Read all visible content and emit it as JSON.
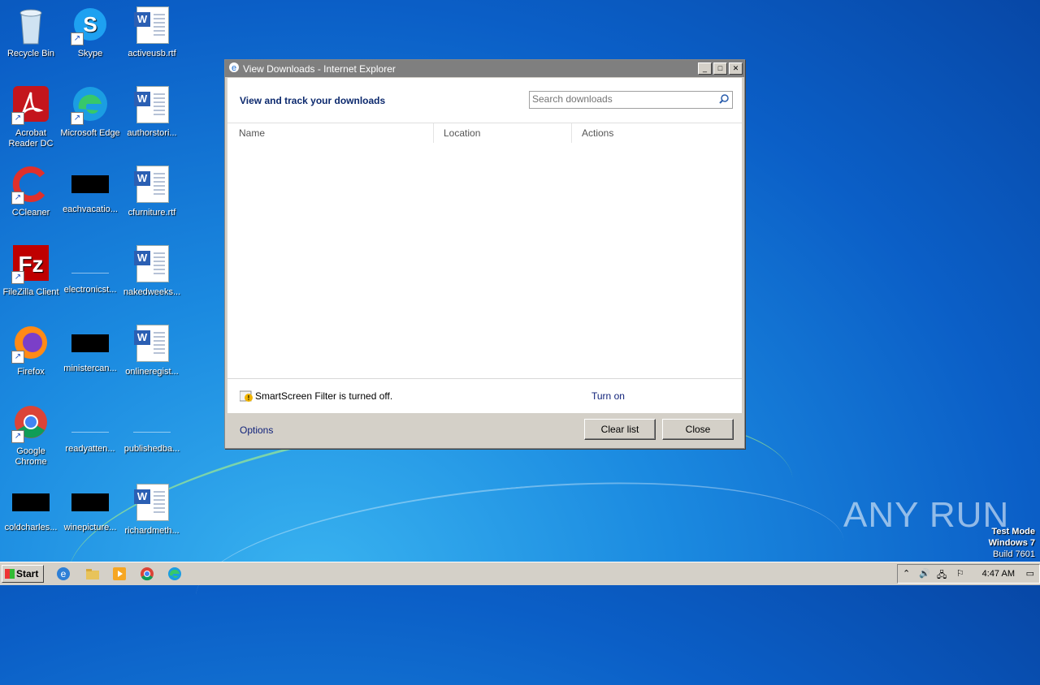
{
  "desktop": {
    "icons": [
      {
        "label": "Recycle Bin"
      },
      {
        "label": "Skype"
      },
      {
        "label": "activeusb.rtf"
      },
      {
        "label": "Acrobat Reader DC"
      },
      {
        "label": "Microsoft Edge"
      },
      {
        "label": "authorstori..."
      },
      {
        "label": "CCleaner"
      },
      {
        "label": "eachvacatio..."
      },
      {
        "label": "cfurniture.rtf"
      },
      {
        "label": "FileZilla Client"
      },
      {
        "label": "electronicst..."
      },
      {
        "label": "nakedweeks..."
      },
      {
        "label": "Firefox"
      },
      {
        "label": "ministercan..."
      },
      {
        "label": "onlineregist..."
      },
      {
        "label": "Google Chrome"
      },
      {
        "label": "readyatten..."
      },
      {
        "label": "publishedba..."
      },
      {
        "label": "coldcharles..."
      },
      {
        "label": "winepicture..."
      },
      {
        "label": "richardmeth..."
      }
    ]
  },
  "window": {
    "title": "View Downloads - Internet Explorer",
    "heading": "View and track your downloads",
    "search_placeholder": "Search downloads",
    "columns": [
      "Name",
      "Location",
      "Actions"
    ],
    "smartscreen_text": "SmartScreen Filter is turned off.",
    "turn_on_label": "Turn on",
    "options_label": "Options",
    "clear_list_label": "Clear list",
    "close_label": "Close"
  },
  "taskbar": {
    "start_label": "Start",
    "clock": "4:47 AM"
  },
  "watermark": "ANY RUN",
  "test_mode": {
    "line1": "Test Mode",
    "line2": "Windows 7",
    "line3": "Build 7601"
  },
  "colors": {
    "link": "#10227a",
    "heading": "#0d2a6e",
    "titlebar": "#7f7f7f"
  }
}
